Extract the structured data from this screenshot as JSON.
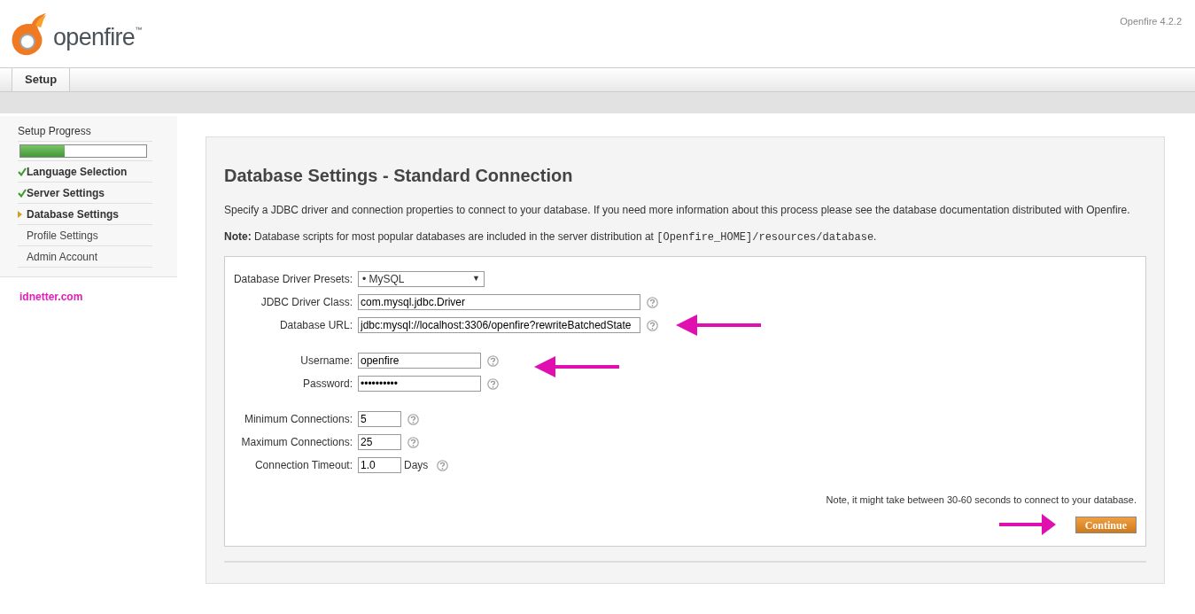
{
  "header": {
    "logo_text": "openfire",
    "trademark": "™",
    "version": "Openfire 4.2.2"
  },
  "tabs": [
    {
      "label": "Setup",
      "selected": true
    }
  ],
  "sidebar": {
    "title": "Setup Progress",
    "progress": {
      "level": 0.35
    },
    "steps": [
      {
        "label": "Language Selection",
        "completed": true,
        "current": false
      },
      {
        "label": "Server Settings",
        "completed": true,
        "current": false
      },
      {
        "label": "Database Settings",
        "completed": false,
        "current": true
      },
      {
        "label": "Profile Settings",
        "completed": false,
        "current": false
      },
      {
        "label": "Admin Account",
        "completed": false,
        "current": false
      }
    ],
    "site_link": "idnetter.com"
  },
  "main": {
    "title": "Database Settings - Standard Connection",
    "intro": "Specify a JDBC driver and connection properties to connect to your database. If you need more information about this process please see the database documentation distributed with Openfire.",
    "note_label": "Note:",
    "note_text": "Database scripts for most popular databases are included in the server distribution at",
    "note_path": "[Openfire_HOME]/resources/database",
    "note_end": ".",
    "field_groups": [
      [
        {
          "kind": "select",
          "label": "Database Driver Presets:",
          "value": "• MySQL",
          "caret": "▼",
          "help": false,
          "annotated": false
        },
        {
          "kind": "text",
          "label": "JDBC Driver Class:",
          "value": "com.mysql.jdbc.Driver",
          "help": true,
          "annotated": false
        },
        {
          "kind": "text",
          "label": "Database URL:",
          "value": "jdbc:mysql://localhost:3306/openfire?rewriteBatchedState",
          "help": true,
          "annotated": true
        }
      ],
      [
        {
          "kind": "text",
          "label": "Username:",
          "value": "openfire",
          "help": true,
          "annotated": true
        },
        {
          "kind": "text",
          "label": "Password:",
          "value": "••••••••••",
          "help": true,
          "annotated": false
        }
      ],
      [
        {
          "kind": "text",
          "label": "Minimum Connections:",
          "value": "5",
          "help": true,
          "annotated": false
        },
        {
          "kind": "text",
          "label": "Maximum Connections:",
          "value": "25",
          "help": true,
          "annotated": false
        },
        {
          "kind": "text",
          "label": "Connection Timeout:",
          "value": "1.0",
          "unit": "Days",
          "help": true,
          "annotated": false
        }
      ]
    ],
    "footnote": "Note, it might take between 30-60 seconds to connect to your database.",
    "continue_button": {
      "label": "Continue",
      "annotated": true
    }
  }
}
